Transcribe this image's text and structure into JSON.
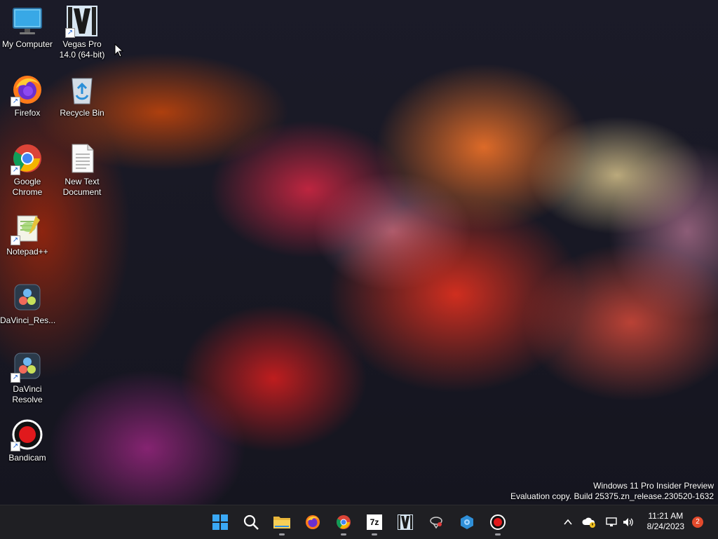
{
  "desktop": {
    "icons": [
      {
        "label": "My Computer"
      },
      {
        "label": "Vegas Pro 14.0 (64-bit)"
      },
      {
        "label": "Firefox"
      },
      {
        "label": "Recycle Bin"
      },
      {
        "label": "Google Chrome"
      },
      {
        "label": "New Text Document"
      },
      {
        "label": "Notepad++"
      },
      {
        "label": "DaVinci_Res..."
      },
      {
        "label": "DaVinci Resolve"
      },
      {
        "label": "Bandicam"
      }
    ],
    "watermark": {
      "line1": "Windows 11 Pro Insider Preview",
      "line2": "Evaluation copy. Build 25375.zn_release.230520-1632"
    }
  },
  "taskbar": {
    "apps": [
      {
        "icon": "windows-start-icon"
      },
      {
        "icon": "search-icon"
      },
      {
        "icon": "file-explorer-icon"
      },
      {
        "icon": "firefox-icon"
      },
      {
        "icon": "chrome-icon"
      },
      {
        "icon": "7zip-icon",
        "text": "7z"
      },
      {
        "icon": "vegas-pro-icon"
      },
      {
        "icon": "network-tool-icon"
      },
      {
        "icon": "settings-box-icon"
      },
      {
        "icon": "bandicam-icon"
      }
    ],
    "clock": {
      "time": "11:21 AM",
      "date": "8/24/2023"
    },
    "notifications": "2"
  },
  "colors": {
    "taskbar": "#1f1f23",
    "accent": "#0a84ff",
    "badge": "#e34a2c"
  }
}
